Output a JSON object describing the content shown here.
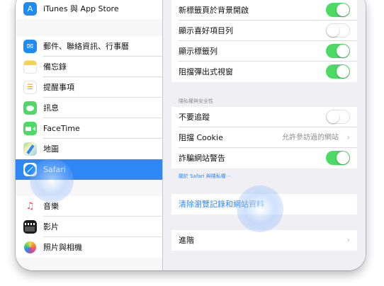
{
  "sidebar": {
    "items": [
      {
        "label": "iTunes 與 App Store",
        "icon": "app-store-icon",
        "color": "#1e8cf5",
        "glyph": "A"
      },
      {
        "label": "郵件、聯絡資訊、行事曆",
        "icon": "mail-icon",
        "color": "#1e8cf5",
        "glyph": "✉"
      },
      {
        "label": "備忘錄",
        "icon": "notes-icon",
        "color": "#f7d34a",
        "glyph": "≡"
      },
      {
        "label": "提醒事項",
        "icon": "reminders-icon",
        "color": "#ffffff",
        "glyph": "☰"
      },
      {
        "label": "訊息",
        "icon": "messages-icon",
        "color": "#4cd964",
        "glyph": "●"
      },
      {
        "label": "FaceTime",
        "icon": "facetime-icon",
        "color": "#4cd964",
        "glyph": "■"
      },
      {
        "label": "地圖",
        "icon": "maps-icon",
        "color": "#8fd0f5",
        "glyph": "◆"
      },
      {
        "label": "Safari",
        "icon": "safari-icon",
        "color": "#1e8cf5",
        "glyph": "◎"
      },
      {
        "label": "音樂",
        "icon": "music-icon",
        "color": "#ffffff",
        "glyph": "♫"
      },
      {
        "label": "影片",
        "icon": "videos-icon",
        "color": "#ffffff",
        "glyph": "🎬"
      },
      {
        "label": "照片與相機",
        "icon": "photos-icon",
        "color": "#ffffff",
        "glyph": "✿"
      }
    ]
  },
  "detail": {
    "general_rows": [
      {
        "label": "新標籤頁於背景開啟",
        "on": true
      },
      {
        "label": "顯示喜好項目列",
        "on": false
      },
      {
        "label": "顯示標籤列",
        "on": true
      },
      {
        "label": "阻擋彈出式視窗",
        "on": true
      }
    ],
    "privacy_header": "隱私權與安全性",
    "privacy_rows": [
      {
        "label": "不要追蹤",
        "type": "toggle",
        "on": false
      },
      {
        "label": "阻擋 Cookie",
        "type": "disclosure",
        "value": "允許參訪過的網站"
      },
      {
        "label": "詐騙網站警告",
        "type": "toggle",
        "on": true
      }
    ],
    "privacy_link": "關於 Safari 與隱私權⋯",
    "clear_label": "清除瀏覽記錄和網站資料",
    "advanced_label": "進階"
  },
  "colors": {
    "accent": "#2f87f6",
    "toggle_on": "#4cd964"
  }
}
